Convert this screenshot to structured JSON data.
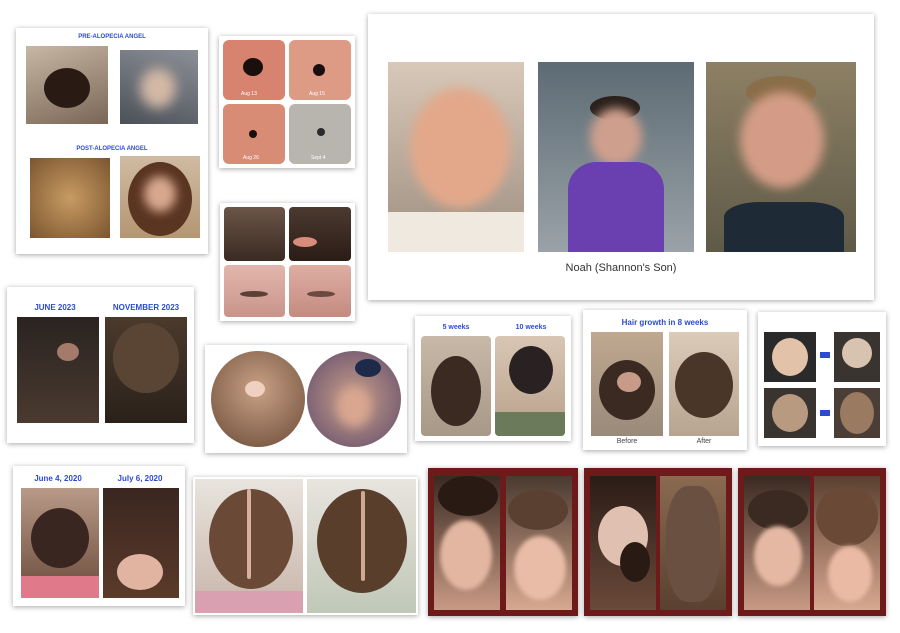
{
  "collage": {
    "card_angel": {
      "top_label": "PRE-ALOPECIA ANGEL",
      "bottom_label": "POST-ALOPECIA ANGEL"
    },
    "card_spot": {
      "captions": [
        "Aug 13",
        "Aug 15",
        "Aug 26",
        "Sept 4"
      ]
    },
    "card_noah": {
      "caption": "Noah (Shannon's Son)"
    },
    "card_june_nov": {
      "label_left": "JUNE 2023",
      "label_right": "NOVEMBER 2023"
    },
    "card_weeks": {
      "label_left": "5 weeks",
      "label_right": "10 weeks"
    },
    "card_growth": {
      "title": "Hair growth in 8 weeks",
      "before": "Before",
      "after": "After"
    },
    "card_2020": {
      "label_left": "June 4, 2020",
      "label_right": "July 6, 2020"
    }
  },
  "colors": {
    "label_blue": "#2b4bd1",
    "maroon_frame": "#6e1a1a"
  }
}
